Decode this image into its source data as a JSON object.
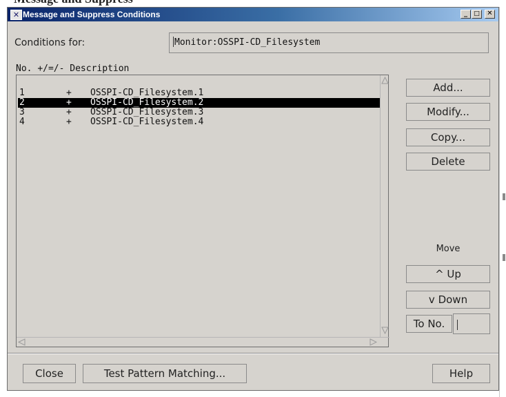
{
  "window": {
    "title": "Message and Suppress Conditions",
    "icon_text": "✕",
    "controls": {
      "minimize": "_",
      "maximize": "□",
      "close": "✕"
    }
  },
  "conditions": {
    "label": "Conditions for:",
    "value": "Monitor:OSSPI-CD_Filesystem"
  },
  "list": {
    "headers": {
      "no": "No.",
      "sign": "+/=/-",
      "description": "Description"
    },
    "rows": [
      {
        "no": "1",
        "sign": "+",
        "description": "OSSPI-CD_Filesystem.1",
        "selected": false
      },
      {
        "no": "2",
        "sign": "+",
        "description": "OSSPI-CD_Filesystem.2",
        "selected": true
      },
      {
        "no": "3",
        "sign": "+",
        "description": "OSSPI-CD_Filesystem.3",
        "selected": false
      },
      {
        "no": "4",
        "sign": "+",
        "description": "OSSPI-CD_Filesystem.4",
        "selected": false
      }
    ]
  },
  "actions": {
    "add": "Add...",
    "modify": "Modify...",
    "copy": "Copy...",
    "delete": "Delete"
  },
  "move": {
    "label": "Move",
    "up": "^  Up",
    "down": "v Down",
    "to_no": "To No."
  },
  "bottom": {
    "close": "Close",
    "test": "Test Pattern Matching...",
    "help": "Help"
  },
  "colors": {
    "window_bg": "#d6d3ce",
    "title_start": "#0a246a",
    "title_end": "#a6caf0",
    "selection": "#000000"
  }
}
